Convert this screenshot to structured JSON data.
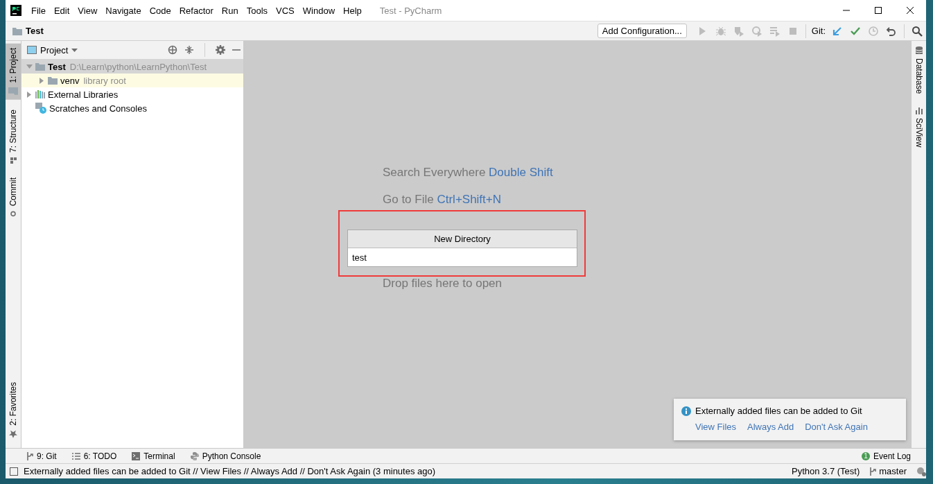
{
  "window": {
    "title": "Test - PyCharm"
  },
  "menu": [
    "File",
    "Edit",
    "View",
    "Navigate",
    "Code",
    "Refactor",
    "Run",
    "Tools",
    "VCS",
    "Window",
    "Help"
  ],
  "breadcrumb": "Test",
  "toolbar": {
    "run_config": "Add Configuration...",
    "git_label": "Git:"
  },
  "left_tools": [
    {
      "label": "1: Project",
      "kind": "folder",
      "selected": true
    },
    {
      "label": "7: Structure",
      "kind": "structure",
      "selected": false
    },
    {
      "label": "Commit",
      "kind": "commit",
      "selected": false
    }
  ],
  "left_bottom_tools": [
    {
      "label": "2: Favorites",
      "kind": "star",
      "selected": false
    }
  ],
  "project_panel": {
    "title": "Project",
    "tree": [
      {
        "name": "Test",
        "path": "D:\\Learn\\python\\LearnPython\\Test",
        "kind": "folder",
        "expandable": true,
        "expanded": true,
        "selected": true,
        "highlighted": false,
        "children": [
          {
            "name": "venv",
            "hint": "library root",
            "kind": "folder",
            "expandable": true,
            "expanded": false,
            "selected": false,
            "highlighted": true
          }
        ]
      },
      {
        "name": "External Libraries",
        "kind": "libraries",
        "expandable": true,
        "expanded": false,
        "selected": false,
        "highlighted": false
      },
      {
        "name": "Scratches and Consoles",
        "kind": "scratches",
        "expandable": false,
        "selected": false,
        "highlighted": false
      }
    ]
  },
  "editor_hints": [
    {
      "text": "Search Everywhere",
      "shortcut": "Double Shift",
      "gap_before": false
    },
    {
      "text": "Go to File",
      "shortcut": "Ctrl+Shift+N",
      "gap_before": false
    },
    {
      "text": "Drop files here to open",
      "gap_before": true
    }
  ],
  "dialog": {
    "title": "New Directory",
    "value": "test"
  },
  "right_tools": [
    {
      "label": "Database",
      "kind": "database"
    },
    {
      "label": "SciView",
      "kind": "sciview"
    }
  ],
  "notification": {
    "message": "Externally added files can be added to Git",
    "actions": [
      "View Files",
      "Always Add",
      "Don't Ask Again"
    ]
  },
  "bottom_tools": [
    {
      "label": "9: Git",
      "kind": "git"
    },
    {
      "label": "6: TODO",
      "kind": "todo"
    },
    {
      "label": "Terminal",
      "kind": "terminal"
    },
    {
      "label": "Python Console",
      "kind": "python"
    }
  ],
  "event_log": {
    "label": "Event Log",
    "count": "1"
  },
  "status_bar": {
    "message": "Externally added files can be added to Git // View Files // Always Add // Don't Ask Again (3 minutes ago)",
    "interpreter": "Python 3.7 (Test)",
    "branch": "master"
  }
}
